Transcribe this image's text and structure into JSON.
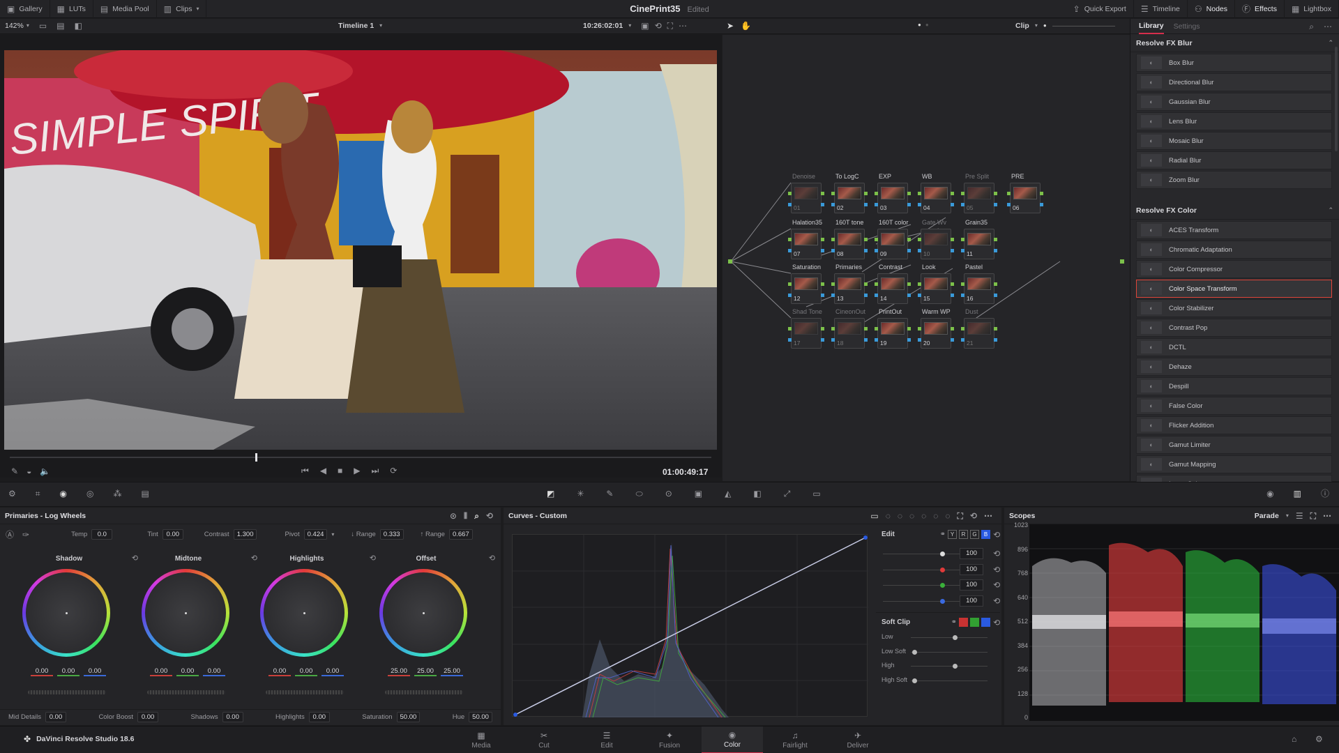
{
  "topbar": {
    "gallery": "Gallery",
    "luts": "LUTs",
    "media_pool": "Media Pool",
    "clips": "Clips",
    "project_title": "CinePrint35",
    "project_status": "Edited",
    "quick_export": "Quick Export",
    "timeline": "Timeline",
    "nodes": "Nodes",
    "effects": "Effects",
    "lightbox": "Lightbox"
  },
  "viewer_bar": {
    "zoom": "142%",
    "timeline_name": "Timeline 1",
    "timecode": "10:26:02:01",
    "clip_mode": "Clip"
  },
  "viewer": {
    "timecode": "01:00:49:17",
    "scrub_position": 0.35
  },
  "nodes": [
    {
      "label": "Denoise",
      "num": "01",
      "off": true
    },
    {
      "label": "To LogC",
      "num": "02",
      "off": false
    },
    {
      "label": "EXP",
      "num": "03",
      "off": false
    },
    {
      "label": "WB",
      "num": "04",
      "off": false
    },
    {
      "label": "Pre Split",
      "num": "05",
      "off": true
    },
    {
      "label": "PRE",
      "num": "06",
      "off": false
    },
    {
      "label": "Halation35",
      "num": "07",
      "off": false
    },
    {
      "label": "160T tone",
      "num": "08",
      "off": false
    },
    {
      "label": "160T color",
      "num": "09",
      "off": false
    },
    {
      "label": "Gate Wv",
      "num": "10",
      "off": true
    },
    {
      "label": "Grain35",
      "num": "11",
      "off": false
    },
    {
      "label": "Saturation",
      "num": "12",
      "off": false
    },
    {
      "label": "Primaries",
      "num": "13",
      "off": false
    },
    {
      "label": "Contrast",
      "num": "14",
      "off": false
    },
    {
      "label": "Look",
      "num": "15",
      "off": false
    },
    {
      "label": "Pastel",
      "num": "16",
      "off": false
    },
    {
      "label": "Shad Tone",
      "num": "17",
      "off": true
    },
    {
      "label": "CineonOut",
      "num": "18",
      "off": true
    },
    {
      "label": "PrintOut",
      "num": "19",
      "off": false
    },
    {
      "label": "Warm WP",
      "num": "20",
      "off": false
    },
    {
      "label": "Dust",
      "num": "21",
      "off": true
    }
  ],
  "library": {
    "tab_library": "Library",
    "tab_settings": "Settings",
    "blur_category": "Resolve FX Blur",
    "blur_items": [
      "Box Blur",
      "Directional Blur",
      "Gaussian Blur",
      "Lens Blur",
      "Mosaic Blur",
      "Radial Blur",
      "Zoom Blur"
    ],
    "color_category": "Resolve FX Color",
    "color_items": [
      "ACES Transform",
      "Chromatic Adaptation",
      "Color Compressor",
      "Color Space Transform",
      "Color Stabilizer",
      "Contrast Pop",
      "DCTL",
      "Dehaze",
      "Despill",
      "False Color",
      "Flicker Addition",
      "Gamut Limiter",
      "Gamut Mapping",
      "Invert Color"
    ],
    "selected": "Color Space Transform"
  },
  "primaries": {
    "title": "Primaries - Log Wheels",
    "temp_label": "Temp",
    "temp": "0.0",
    "tint_label": "Tint",
    "tint": "0.00",
    "contrast_label": "Contrast",
    "contrast": "1.300",
    "pivot_label": "Pivot",
    "pivot": "0.424",
    "lrange_label": "↓ Range",
    "lrange": "0.333",
    "hrange_label": "↑ Range",
    "hrange": "0.667",
    "wheels": [
      {
        "name": "Shadow",
        "v1": "0.00",
        "v2": "0.00",
        "v3": "0.00"
      },
      {
        "name": "Midtone",
        "v1": "0.00",
        "v2": "0.00",
        "v3": "0.00"
      },
      {
        "name": "Highlights",
        "v1": "0.00",
        "v2": "0.00",
        "v3": "0.00"
      },
      {
        "name": "Offset",
        "v1": "25.00",
        "v2": "25.00",
        "v3": "25.00"
      }
    ],
    "mid_detail_label": "Mid Details",
    "mid_detail": "0.00",
    "color_boost_label": "Color Boost",
    "color_boost": "0.00",
    "shadows_label": "Shadows",
    "shadows": "0.00",
    "highlights_label": "Highlights",
    "highlights": "0.00",
    "saturation_label": "Saturation",
    "saturation": "50.00",
    "hue_label": "Hue",
    "hue": "50.00"
  },
  "curves": {
    "title": "Curves - Custom",
    "edit_label": "Edit",
    "channels": [
      "Y",
      "R",
      "G",
      "B"
    ],
    "values": [
      "100",
      "100",
      "100",
      "100"
    ],
    "soft_clip_label": "Soft Clip",
    "low": "Low",
    "low_soft": "Low Soft",
    "high": "High",
    "high_soft": "High Soft"
  },
  "scopes": {
    "title": "Scopes",
    "mode": "Parade",
    "scale": [
      "1023",
      "896",
      "768",
      "640",
      "512",
      "384",
      "256",
      "128",
      "0"
    ]
  },
  "bottom": {
    "app_name": "DaVinci Resolve Studio 18.6",
    "pages": [
      "Media",
      "Cut",
      "Edit",
      "Fusion",
      "Color",
      "Fairlight",
      "Deliver"
    ],
    "active_page": "Color"
  },
  "colors": {
    "accent": "#d62e4c",
    "selection": "#e0453a",
    "node_pin": "#7cc04a",
    "key_pin": "#3a9ad9"
  }
}
